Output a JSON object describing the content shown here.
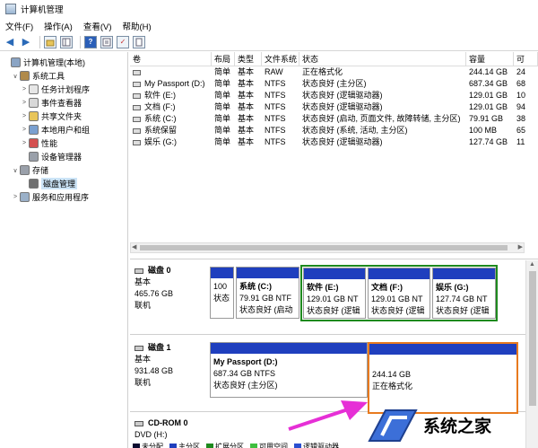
{
  "window": {
    "title": "计算机管理"
  },
  "menu": [
    "文件(F)",
    "操作(A)",
    "查看(V)",
    "帮助(H)"
  ],
  "toolbar": [
    "back-arrow-icon",
    "forward-arrow-icon",
    "folder-up-icon",
    "console-tree-icon",
    "help-icon",
    "properties-icon",
    "check-icon",
    "doc-icon"
  ],
  "tree": [
    {
      "label": "计算机管理(本地)",
      "indent": 0,
      "arrow": "",
      "icon": "computer-icon"
    },
    {
      "label": "系统工具",
      "indent": 1,
      "arrow": "∨",
      "icon": "tools-icon"
    },
    {
      "label": "任务计划程序",
      "indent": 2,
      "arrow": ">",
      "icon": "clock-icon"
    },
    {
      "label": "事件查看器",
      "indent": 2,
      "arrow": ">",
      "icon": "event-viewer-icon"
    },
    {
      "label": "共享文件夹",
      "indent": 2,
      "arrow": ">",
      "icon": "shared-folder-icon"
    },
    {
      "label": "本地用户和组",
      "indent": 2,
      "arrow": ">",
      "icon": "users-icon"
    },
    {
      "label": "性能",
      "indent": 2,
      "arrow": ">",
      "icon": "performance-icon"
    },
    {
      "label": "设备管理器",
      "indent": 2,
      "arrow": "",
      "icon": "device-manager-icon"
    },
    {
      "label": "存储",
      "indent": 1,
      "arrow": "∨",
      "icon": "storage-icon"
    },
    {
      "label": "磁盘管理",
      "indent": 2,
      "arrow": "",
      "icon": "disk-management-icon",
      "selected": true
    },
    {
      "label": "服务和应用程序",
      "indent": 1,
      "arrow": ">",
      "icon": "services-icon"
    }
  ],
  "volume_table": {
    "headers": [
      "卷",
      "布局",
      "类型",
      "文件系统",
      "状态",
      "容量",
      "可"
    ],
    "rows": [
      [
        "",
        "简单",
        "基本",
        "RAW",
        "正在格式化",
        "244.14 GB",
        "24"
      ],
      [
        "My Passport (D:)",
        "简单",
        "基本",
        "NTFS",
        "状态良好 (主分区)",
        "687.34 GB",
        "68"
      ],
      [
        "软件 (E:)",
        "简单",
        "基本",
        "NTFS",
        "状态良好 (逻辑驱动器)",
        "129.01 GB",
        "10"
      ],
      [
        "文档 (F:)",
        "简单",
        "基本",
        "NTFS",
        "状态良好 (逻辑驱动器)",
        "129.01 GB",
        "94"
      ],
      [
        "系统 (C:)",
        "简单",
        "基本",
        "NTFS",
        "状态良好 (启动, 页面文件, 故障转储, 主分区)",
        "79.91 GB",
        "38"
      ],
      [
        "系统保留",
        "简单",
        "基本",
        "NTFS",
        "状态良好 (系统, 活动, 主分区)",
        "100 MB",
        "65"
      ],
      [
        "娱乐 (G:)",
        "简单",
        "基本",
        "NTFS",
        "状态良好 (逻辑驱动器)",
        "127.74 GB",
        "11"
      ]
    ]
  },
  "disks": [
    {
      "name": "磁盘 0",
      "type": "基本",
      "size": "465.76 GB",
      "status": "联机",
      "partitions": [
        {
          "name": "",
          "size": "100",
          "status": "状态"
        },
        {
          "name": "系统 (C:)",
          "size": "79.91 GB NTF",
          "status": "状态良好 (启动"
        },
        {
          "name": "软件 (E:)",
          "size": "129.01 GB NT",
          "status": "状态良好 (逻辑"
        },
        {
          "name": "文档 (F:)",
          "size": "129.01 GB NT",
          "status": "状态良好 (逻辑"
        },
        {
          "name": "娱乐 (G:)",
          "size": "127.74 GB NT",
          "status": "状态良好 (逻辑"
        }
      ]
    },
    {
      "name": "磁盘 1",
      "type": "基本",
      "size": "931.48 GB",
      "status": "联机",
      "partitions": [
        {
          "name": "My Passport (D:)",
          "size": "687.34 GB NTFS",
          "status": "状态良好 (主分区)"
        },
        {
          "name": "",
          "size": "244.14 GB",
          "status": "正在格式化"
        }
      ]
    },
    {
      "name": "CD-ROM 0",
      "type": "DVD (H:)",
      "size": "",
      "status": ""
    }
  ],
  "legend": [
    {
      "label": "未分配",
      "color": "#0c0c30"
    },
    {
      "label": "主分区",
      "color": "#1f3fbe"
    },
    {
      "label": "扩展分区",
      "color": "#1e8a1e"
    },
    {
      "label": "可用空间",
      "color": "#3fbf3f"
    },
    {
      "label": "逻辑驱动器",
      "color": "#2a4fd0"
    }
  ],
  "watermark": {
    "text": "系统之家"
  },
  "colors": {
    "primary_partition": "#1f3fbe",
    "selection_green": "#1e8a1e",
    "selection_orange": "#e87a1e",
    "annotation_arrow": "#e62fd6"
  }
}
